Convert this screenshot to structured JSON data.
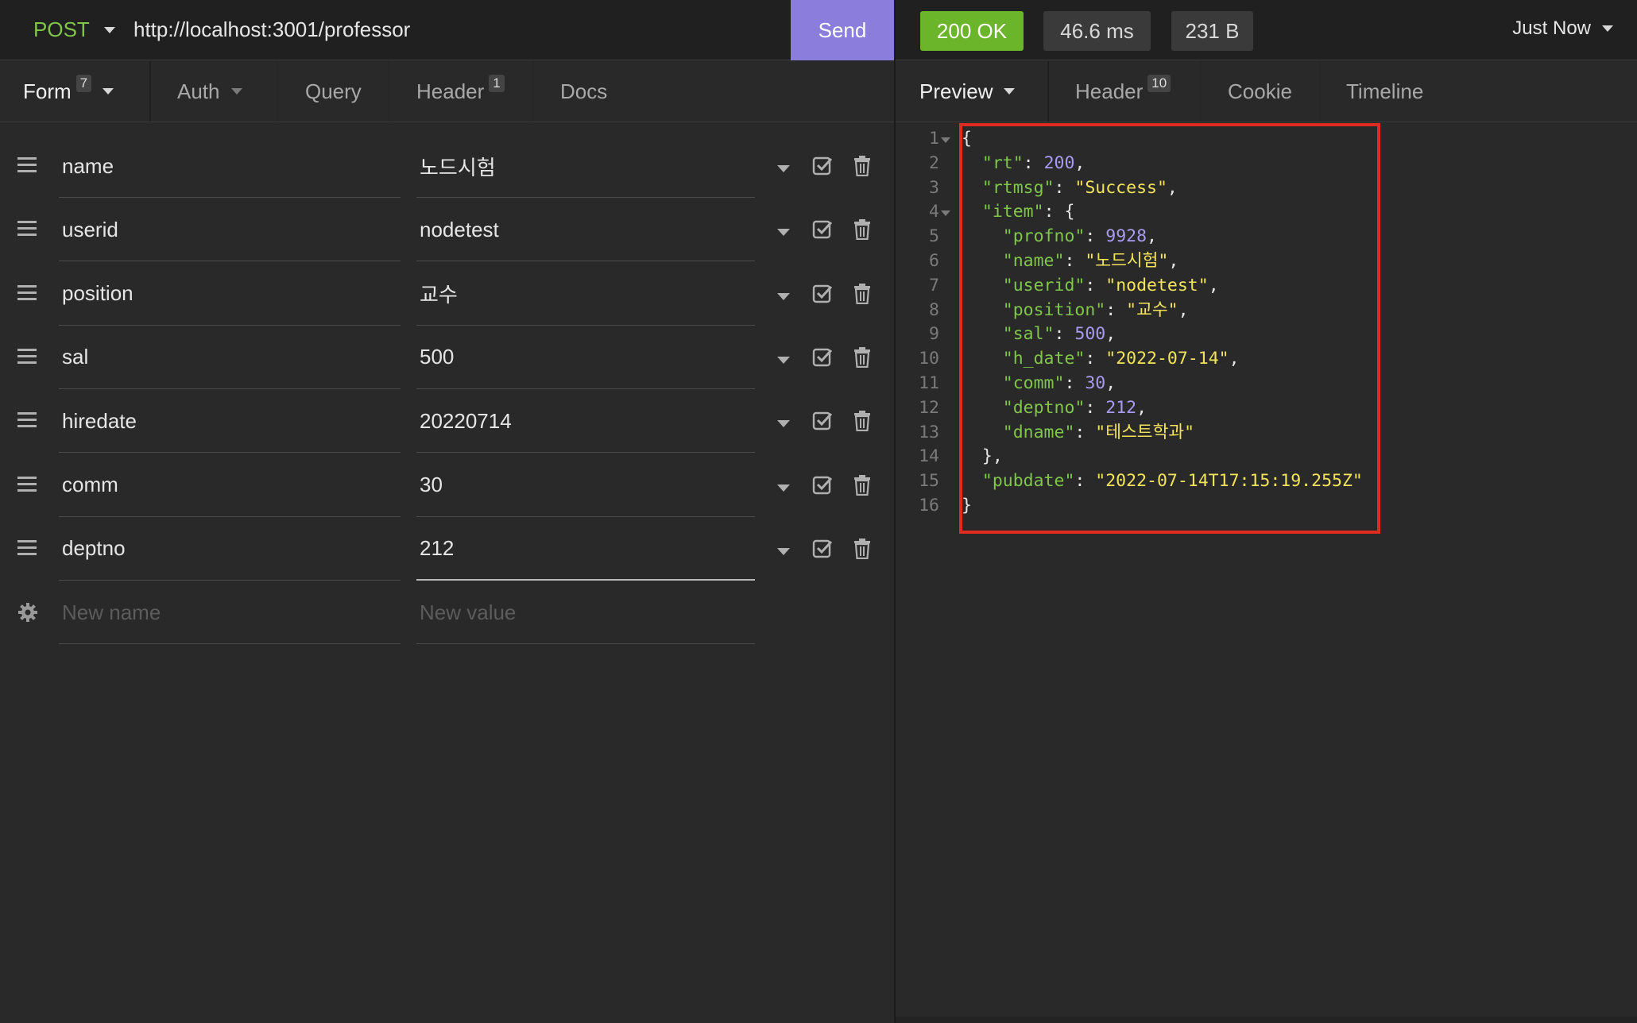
{
  "request": {
    "method": "POST",
    "url": "http://localhost:3001/professor",
    "send_label": "Send"
  },
  "response": {
    "status": "200 OK",
    "time": "46.6 ms",
    "size": "231 B",
    "when": "Just Now"
  },
  "left_tabs": [
    {
      "label": "Form",
      "badge": "7"
    },
    {
      "label": "Auth"
    },
    {
      "label": "Query"
    },
    {
      "label": "Header",
      "badge": "1"
    },
    {
      "label": "Docs"
    }
  ],
  "right_tabs": [
    {
      "label": "Preview"
    },
    {
      "label": "Header",
      "badge": "10"
    },
    {
      "label": "Cookie"
    },
    {
      "label": "Timeline"
    }
  ],
  "form_rows": [
    {
      "name": "name",
      "value": "노드시험"
    },
    {
      "name": "userid",
      "value": "nodetest"
    },
    {
      "name": "position",
      "value": "교수"
    },
    {
      "name": "sal",
      "value": "500"
    },
    {
      "name": "hiredate",
      "value": "20220714"
    },
    {
      "name": "comm",
      "value": "30"
    },
    {
      "name": "deptno",
      "value": "212"
    }
  ],
  "new_row": {
    "name_placeholder": "New name",
    "value_placeholder": "New value"
  },
  "preview_lines": [
    "{",
    "  \"rt\": 200,",
    "  \"rtmsg\": \"Success\",",
    "  \"item\": {",
    "    \"profno\": 9928,",
    "    \"name\": \"노드시험\",",
    "    \"userid\": \"nodetest\",",
    "    \"position\": \"교수\",",
    "    \"sal\": 500,",
    "    \"h_date\": \"2022-07-14\",",
    "    \"comm\": 30,",
    "    \"deptno\": 212,",
    "    \"dname\": \"테스트학과\"",
    "  },",
    "  \"pubdate\": \"2022-07-14T17:15:19.255Z\"",
    "}"
  ],
  "colors": {
    "accent": "#8a7ddb",
    "ok": "#6bb52a",
    "key": "#7fc64a",
    "string": "#f2e45a",
    "number": "#a99bf2",
    "highlight": "#e02b21"
  }
}
